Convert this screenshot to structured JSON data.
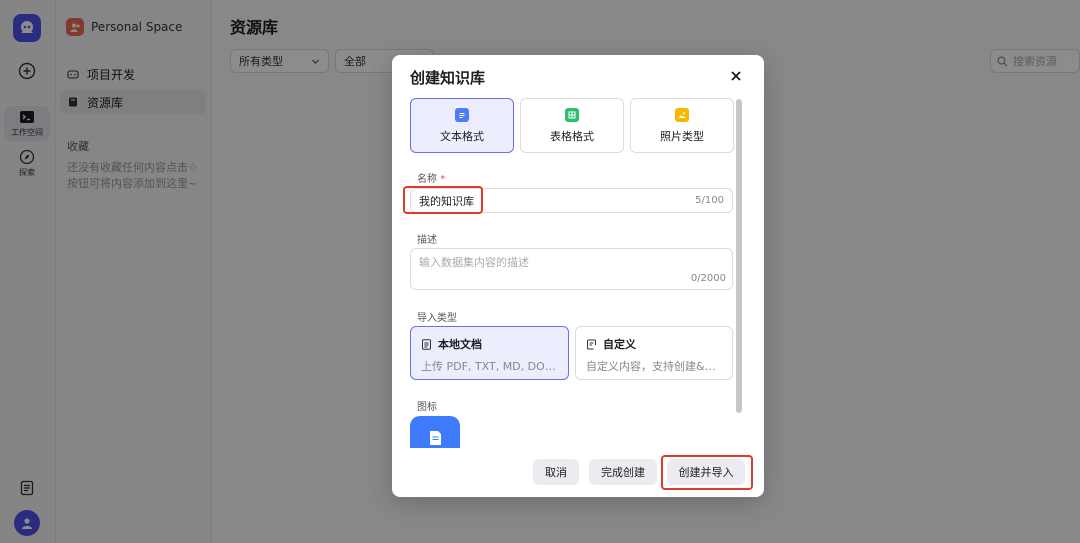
{
  "sidebar": {
    "space_name": "Personal Space",
    "nav": [
      {
        "label": "项目开发"
      },
      {
        "label": "资源库"
      }
    ],
    "favorites_title": "收藏",
    "favorites_empty": "还没有收藏任何内容点击☆按钮可将内容添加到这里~"
  },
  "rail": {
    "workspace_label": "工作空间",
    "explore_label": "探索"
  },
  "main": {
    "title": "资源库",
    "type_filter": "所有类型",
    "scope_filter": "全部",
    "search_placeholder": "搜索资源"
  },
  "modal": {
    "title": "创建知识库",
    "formats": [
      {
        "label": "文本格式"
      },
      {
        "label": "表格格式"
      },
      {
        "label": "照片类型"
      }
    ],
    "name_label": "名称",
    "name_value": "我的知识库",
    "name_counter": "5/100",
    "desc_label": "描述",
    "desc_placeholder": "输入数据集内容的描述",
    "desc_counter": "0/2000",
    "import_label": "导入类型",
    "imports": [
      {
        "title": "本地文档",
        "desc": "上传 PDF, TXT, MD, DOC..."
      },
      {
        "title": "自定义",
        "desc": "自定义内容，支持创建&编辑"
      }
    ],
    "icon_label": "图标",
    "cancel": "取消",
    "finish": "完成创建",
    "create_import": "创建并导入"
  },
  "colors": {
    "accent": "#4d53e8",
    "highlight": "#e03a2f",
    "text_format": "#4d7cf8",
    "table_format": "#2fbf71",
    "photo_format": "#f5b800"
  }
}
